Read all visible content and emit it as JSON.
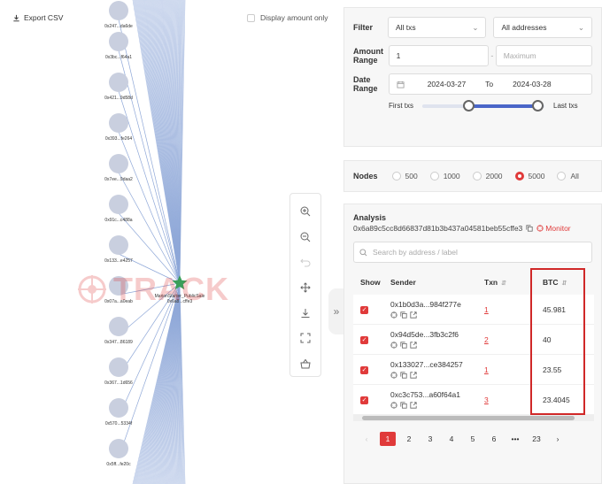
{
  "graph": {
    "export_label": "Export CSV",
    "display_amount_label": "Display amount only",
    "center_label_1": "MarionStarter_PublicSale",
    "center_label_2": "0x6a8...cffe3",
    "watermark": "TRACK",
    "node_labels": [
      "0x247...da6de",
      "0x3bc...f64a1",
      "0x421...9d58d",
      "0x393...fe264",
      "0x7ee...9daa2",
      "0x91c...c488a",
      "0x133...e4257",
      "0x07a...a0eab",
      "0x347...86189",
      "0x367...1d656",
      "0x570...5334f",
      "0x5ff...fe20c"
    ]
  },
  "filter": {
    "filter_label": "Filter",
    "txs_select": "All txs",
    "addresses_select": "All addresses",
    "amount_range_label": "Amount Range",
    "amount_min": "1",
    "amount_sep": "-",
    "amount_max_placeholder": "Maximum",
    "date_range_label": "Date Range",
    "date_from": "2024-03-27",
    "date_to_sep": "To",
    "date_to": "2024-03-28",
    "first_txs": "First txs",
    "last_txs": "Last txs",
    "slider_low": 0.38,
    "slider_high": 0.94
  },
  "nodes": {
    "label": "Nodes",
    "options": [
      "500",
      "1000",
      "2000",
      "5000",
      "All"
    ],
    "selected": "5000"
  },
  "analysis": {
    "title": "Analysis",
    "address": "0x6a89c5cc8d66837d81b3b437a04581beb55cffe3",
    "monitor_label": "Monitor",
    "search_placeholder": "Search by address / label",
    "columns": {
      "show": "Show",
      "sender": "Sender",
      "txn": "Txn",
      "btc": "BTC"
    },
    "rows": [
      {
        "sender": "0x1b0d3a...984f277e",
        "txn": "1",
        "btc": "45.981"
      },
      {
        "sender": "0x94d5de...3fb3c2f6",
        "txn": "2",
        "btc": "40"
      },
      {
        "sender": "0x133027...ce384257",
        "txn": "1",
        "btc": "23.55"
      },
      {
        "sender": "0xc3c753...a60f64a1",
        "txn": "3",
        "btc": "23.4045"
      }
    ],
    "pagination": [
      "1",
      "2",
      "3",
      "4",
      "5",
      "6",
      "•••",
      "23"
    ],
    "active_page": "1"
  },
  "colors": {
    "accent": "#e03a3a",
    "slider": "#4a66c8",
    "edge": "#8fa8d8",
    "node": "#c9cfdf",
    "center": "#3a9e5a"
  }
}
